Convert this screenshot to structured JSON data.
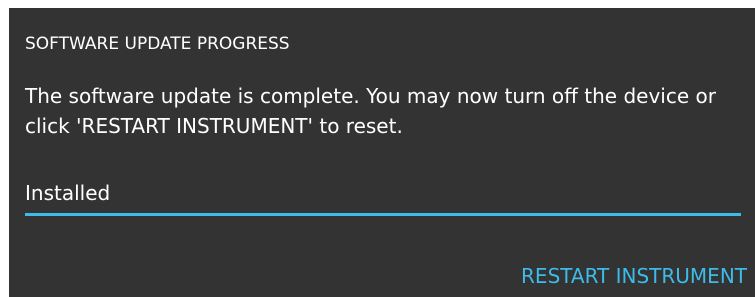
{
  "dialog": {
    "title": "SOFTWARE UPDATE PROGRESS",
    "message": "The software update is complete. You may now turn off the device or click 'RESTART INSTRUMENT' to reset.",
    "progress": {
      "label": "Installed",
      "value": 1.0
    },
    "restart_button_label": "RESTART INSTRUMENT"
  },
  "colors": {
    "dialog_background": "#333333",
    "text": "#ffffff",
    "accent": "#3dbbe9"
  }
}
